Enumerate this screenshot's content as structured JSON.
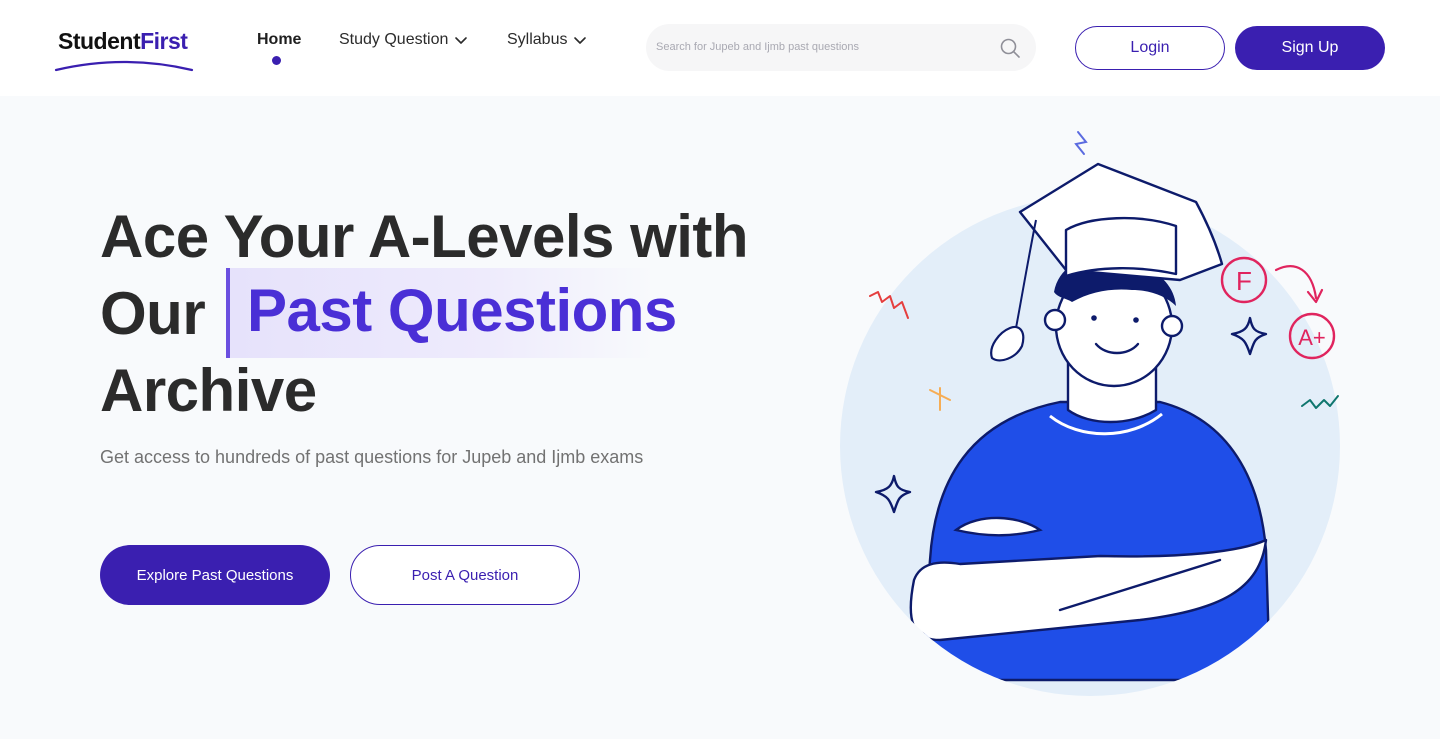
{
  "header": {
    "logo": {
      "part1": "Student",
      "part2": "First"
    },
    "nav": {
      "home": "Home",
      "study_question": "Study Question",
      "syllabus": "Syllabus"
    },
    "search": {
      "placeholder": "Search for Jupeb and Ijmb past questions"
    },
    "login_label": "Login",
    "signup_label": "Sign Up"
  },
  "hero": {
    "title_line1": "Ace Your A-Levels with",
    "title_line2_prefix": "Our",
    "title_highlight": "Past Questions",
    "title_line3": "Archive",
    "subtitle": "Get access to hundreds of past questions for Jupeb and Ijmb exams",
    "explore_label": "Explore Past Questions",
    "post_label": "Post A Question",
    "badge_fail": "F",
    "badge_pass": "A+"
  },
  "colors": {
    "brand": "#3a1fb0",
    "highlight_text": "#4a2fd6",
    "shirt": "#1f4ee8",
    "outline": "#0d1b6b",
    "circle_bg": "#e3eef9",
    "grade_red": "#e0245e"
  },
  "icons": [
    "search-icon",
    "chevron-down-icon",
    "graduate-student-illustration"
  ]
}
